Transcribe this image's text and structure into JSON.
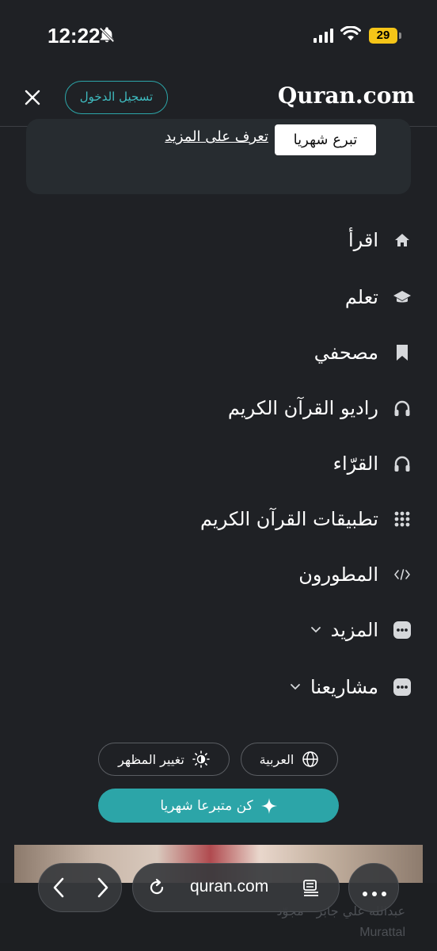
{
  "status_bar": {
    "time": "12:22",
    "battery_level": "29",
    "icons": [
      "bell-off-icon",
      "signal-icon",
      "wifi-icon",
      "battery-icon"
    ]
  },
  "header": {
    "logo": "Quran.com",
    "login_label": "تسجيل الدخول",
    "close_icon": "close-icon"
  },
  "donate_card": {
    "donate_label": "تبرع شهريا",
    "learn_more_label": "تعرف على المزيد"
  },
  "nav": {
    "items": [
      {
        "label": "اقرأ",
        "icon": "home-icon"
      },
      {
        "label": "تعلم",
        "icon": "graduation-cap-icon"
      },
      {
        "label": "مصحفي",
        "icon": "bookmark-icon"
      },
      {
        "label": "راديو القرآن الكريم",
        "icon": "headphones-icon"
      },
      {
        "label": "القرّاء",
        "icon": "headphones-icon"
      },
      {
        "label": "تطبيقات القرآن الكريم",
        "icon": "grid-dots-icon"
      },
      {
        "label": "المطورون",
        "icon": "code-icon"
      },
      {
        "label": "المزيد",
        "icon": "more-icon",
        "expandable": true
      },
      {
        "label": "مشاريعنا",
        "icon": "more-icon",
        "expandable": true
      }
    ]
  },
  "footer": {
    "language_label": "العربية",
    "theme_label": "تغيير المظهر",
    "donor_label": "كن متبرعا شهريا"
  },
  "background_caption": {
    "line1": "عبدالله علي جابر - مجوّد",
    "line2": "Murattal"
  },
  "browser": {
    "url": "quran.com"
  },
  "colors": {
    "background": "#1f2125",
    "accent": "#2ca5a8",
    "card": "#272c30",
    "icon": "#d6d8db"
  }
}
